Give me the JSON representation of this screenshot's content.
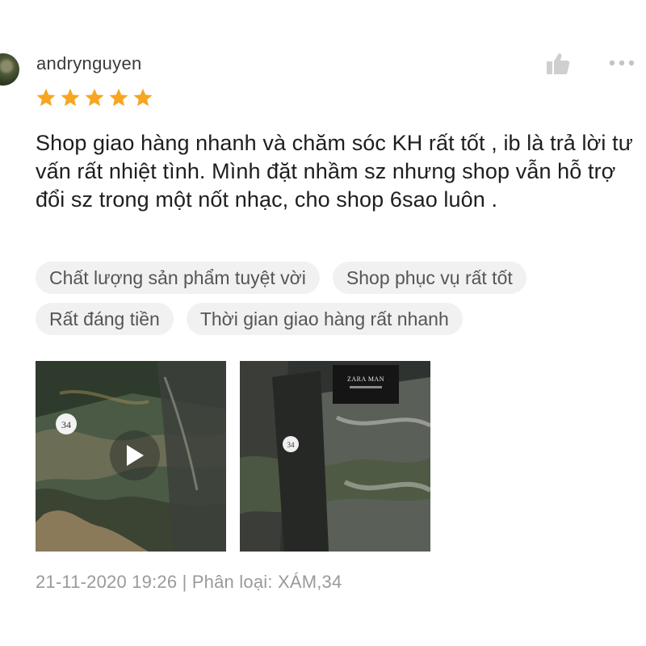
{
  "review": {
    "username": "andrynguyen",
    "rating": 5,
    "rating_max": 5,
    "text": "Shop giao hàng nhanh và chăm sóc KH rất tốt , ib là trả lời tư vấn rất nhiệt tình. Mình đặt nhầm sz nhưng shop vẫn hỗ trợ đổi sz trong một nốt nhạc, cho shop 6sao luôn .",
    "tags": [
      "Chất lượng sản phẩm tuyệt vời",
      "Shop phục vụ rất tốt",
      "Rất đáng tiền",
      "Thời gian giao hàng rất nhanh"
    ],
    "media": [
      {
        "type": "video",
        "tag_label": "34"
      },
      {
        "type": "image",
        "tag_label": "34",
        "brand_label": "ZARA MAN"
      }
    ],
    "meta": "21-11-2020 19:26 | Phân loại: XÁM,34"
  },
  "icons": {
    "like": "thumbs-up-icon",
    "more": "more-horizontal-icon",
    "star": "star-icon",
    "play": "play-icon"
  },
  "colors": {
    "star": "#f6a623",
    "tag_bg": "#f1f1f1",
    "meta_text": "#9a9a9a"
  }
}
